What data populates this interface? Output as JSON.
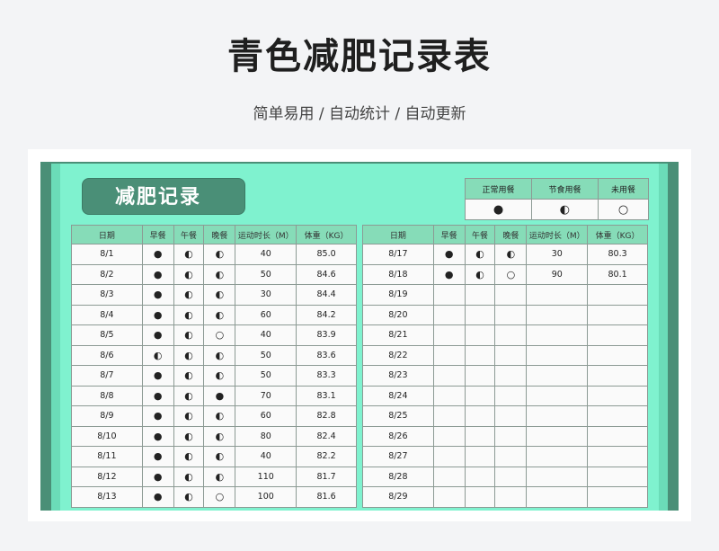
{
  "page": {
    "title": "青色减肥记录表",
    "subtitle": "简单易用 / 自动统计 / 自动更新"
  },
  "sheet": {
    "title": "减肥记录",
    "legend": {
      "headers": [
        "正常用餐",
        "节食用餐",
        "未用餐"
      ],
      "symbols": [
        "●",
        "◐",
        "○"
      ]
    },
    "columns": [
      "日期",
      "早餐",
      "午餐",
      "晚餐",
      "运动时长（M）",
      "体重（KG）"
    ],
    "left_rows": [
      {
        "date": "8/1",
        "breakfast": "●",
        "lunch": "◐",
        "dinner": "◐",
        "exercise": "40",
        "weight": "85.0"
      },
      {
        "date": "8/2",
        "breakfast": "●",
        "lunch": "◐",
        "dinner": "◐",
        "exercise": "50",
        "weight": "84.6"
      },
      {
        "date": "8/3",
        "breakfast": "●",
        "lunch": "◐",
        "dinner": "◐",
        "exercise": "30",
        "weight": "84.4"
      },
      {
        "date": "8/4",
        "breakfast": "●",
        "lunch": "◐",
        "dinner": "◐",
        "exercise": "60",
        "weight": "84.2"
      },
      {
        "date": "8/5",
        "breakfast": "●",
        "lunch": "◐",
        "dinner": "○",
        "exercise": "40",
        "weight": "83.9"
      },
      {
        "date": "8/6",
        "breakfast": "◐",
        "lunch": "◐",
        "dinner": "◐",
        "exercise": "50",
        "weight": "83.6"
      },
      {
        "date": "8/7",
        "breakfast": "●",
        "lunch": "◐",
        "dinner": "◐",
        "exercise": "50",
        "weight": "83.3"
      },
      {
        "date": "8/8",
        "breakfast": "●",
        "lunch": "◐",
        "dinner": "●",
        "exercise": "70",
        "weight": "83.1"
      },
      {
        "date": "8/9",
        "breakfast": "●",
        "lunch": "◐",
        "dinner": "◐",
        "exercise": "60",
        "weight": "82.8"
      },
      {
        "date": "8/10",
        "breakfast": "●",
        "lunch": "◐",
        "dinner": "◐",
        "exercise": "80",
        "weight": "82.4"
      },
      {
        "date": "8/11",
        "breakfast": "●",
        "lunch": "◐",
        "dinner": "◐",
        "exercise": "40",
        "weight": "82.2"
      },
      {
        "date": "8/12",
        "breakfast": "●",
        "lunch": "◐",
        "dinner": "◐",
        "exercise": "110",
        "weight": "81.7"
      },
      {
        "date": "8/13",
        "breakfast": "●",
        "lunch": "◐",
        "dinner": "○",
        "exercise": "100",
        "weight": "81.6"
      }
    ],
    "right_rows": [
      {
        "date": "8/17",
        "breakfast": "●",
        "lunch": "◐",
        "dinner": "◐",
        "exercise": "30",
        "weight": "80.3"
      },
      {
        "date": "8/18",
        "breakfast": "●",
        "lunch": "◐",
        "dinner": "○",
        "exercise": "90",
        "weight": "80.1"
      },
      {
        "date": "8/19",
        "breakfast": "",
        "lunch": "",
        "dinner": "",
        "exercise": "",
        "weight": ""
      },
      {
        "date": "8/20",
        "breakfast": "",
        "lunch": "",
        "dinner": "",
        "exercise": "",
        "weight": ""
      },
      {
        "date": "8/21",
        "breakfast": "",
        "lunch": "",
        "dinner": "",
        "exercise": "",
        "weight": ""
      },
      {
        "date": "8/22",
        "breakfast": "",
        "lunch": "",
        "dinner": "",
        "exercise": "",
        "weight": ""
      },
      {
        "date": "8/23",
        "breakfast": "",
        "lunch": "",
        "dinner": "",
        "exercise": "",
        "weight": ""
      },
      {
        "date": "8/24",
        "breakfast": "",
        "lunch": "",
        "dinner": "",
        "exercise": "",
        "weight": ""
      },
      {
        "date": "8/25",
        "breakfast": "",
        "lunch": "",
        "dinner": "",
        "exercise": "",
        "weight": ""
      },
      {
        "date": "8/26",
        "breakfast": "",
        "lunch": "",
        "dinner": "",
        "exercise": "",
        "weight": ""
      },
      {
        "date": "8/27",
        "breakfast": "",
        "lunch": "",
        "dinner": "",
        "exercise": "",
        "weight": ""
      },
      {
        "date": "8/28",
        "breakfast": "",
        "lunch": "",
        "dinner": "",
        "exercise": "",
        "weight": ""
      },
      {
        "date": "8/29",
        "breakfast": "",
        "lunch": "",
        "dinner": "",
        "exercise": "",
        "weight": ""
      }
    ],
    "colors": {
      "frame_dark": "#4a8f77",
      "sheet_bg": "#7ff2cf",
      "header_bg": "#86dcb8",
      "cell_bg": "#fafafa"
    }
  }
}
